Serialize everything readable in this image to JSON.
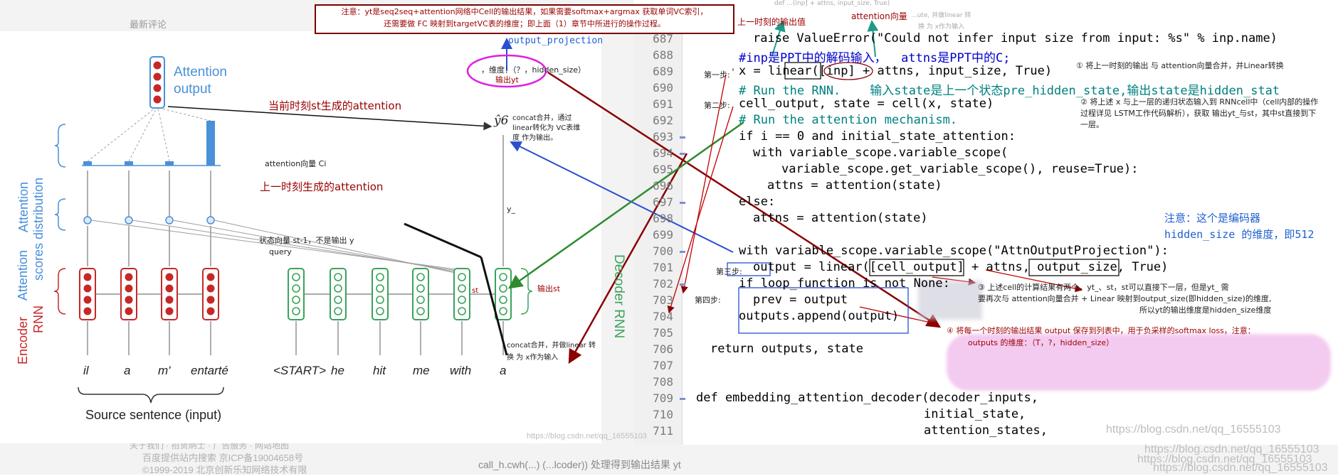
{
  "top_note": {
    "line1": "注意：yt是seq2seq+attention网络中Cell的输出结果，如果需要softmax+argmax 获取单词VC索引，",
    "line2": "还需要做 FC 映射到targetVC表的维度；即上面（1）章节中所进行的操作过程。"
  },
  "background": {
    "recent_comments": "最新评论",
    "footer1": "百度提供站内搜索 京ICP备19004658号",
    "footer2": "©1999-2019 北京创新乐知网络技术有限",
    "partial_link": "关于我们 · 招贤纳士 · 广告服务 · 网站地图",
    "bottom_code": "call_h.cwh(...)  (...lcoder)) 处理得到输出结果 yt"
  },
  "diagram": {
    "attention_output": [
      "Attention",
      "output"
    ],
    "attention_distribution": [
      "Attention",
      "distribution"
    ],
    "attention_scores": [
      "Attention",
      "scores"
    ],
    "encoder_rnn": [
      "Encoder",
      "RNN"
    ],
    "decoder_rnn": "Decoder RNN",
    "source_words": [
      "il",
      "a",
      "m'",
      "entarté"
    ],
    "target_words": [
      "<START>",
      "he",
      "hit",
      "me",
      "with",
      "a"
    ],
    "source_sentence": "Source sentence (input)",
    "y_hat": "ŷ6",
    "current_attention": "当前时刻st生成的attention",
    "prev_attention": "上一时刻生成的attention",
    "attention_vector_ci": "attention向量 Ci",
    "state_vector": "状态向量 st-1，不是输出 y",
    "query": "query",
    "concat_note_1": "concat合并，通过",
    "concat_note_2": "linear转化为 VC表维",
    "concat_note_3": "度 作为输出。",
    "y_underscore": "y_",
    "st_label": "st",
    "output_st": "输出st",
    "concat_note_b1": "concat合并，并做linear 转",
    "concat_note_b2": "换 为 x作为输入",
    "output_projection": "output_projection",
    "dim_label": "，维度：（？，hidden_size）",
    "output_yt": "输出yt"
  },
  "code": {
    "lines": [
      {
        "num": "687",
        "text": "raise ValueError(\"Could not infer input size from input: %s\" % inp.name)"
      },
      {
        "num": "688",
        "text": "#inp是PPT中的解码输入，  attns是PPT中的C;"
      },
      {
        "num": "689",
        "text": "x = linear([inp] + attns, input_size, True)"
      },
      {
        "num": "690",
        "text": "# Run the RNN.    输入state是上一个状态pre_hidden_state,输出state是hidden_stat"
      },
      {
        "num": "691",
        "text": "cell_output, state = cell(x, state)"
      },
      {
        "num": "692",
        "text": "# Run the attention mechanism."
      },
      {
        "num": "693",
        "text": "if i == 0 and initial_state_attention:"
      },
      {
        "num": "694",
        "text": "with variable_scope.variable_scope("
      },
      {
        "num": "695",
        "text": "variable_scope.get_variable_scope(), reuse=True):"
      },
      {
        "num": "696",
        "text": "attns = attention(state)"
      },
      {
        "num": "697",
        "text": "else:"
      },
      {
        "num": "698",
        "text": "attns = attention(state)"
      },
      {
        "num": "699",
        "text": ""
      },
      {
        "num": "700",
        "text": "with variable_scope.variable_scope(\"AttnOutputProjection\"):"
      },
      {
        "num": "701",
        "text": "output = linear([cell_output] + attns, output_size, True)"
      },
      {
        "num": "702",
        "text": "if loop_function is not None:"
      },
      {
        "num": "703",
        "text": "prev = output"
      },
      {
        "num": "704",
        "text": "outputs.append(output)"
      },
      {
        "num": "705",
        "text": ""
      },
      {
        "num": "706",
        "text": "return outputs, state"
      },
      {
        "num": "707",
        "text": ""
      },
      {
        "num": "708",
        "text": ""
      },
      {
        "num": "709",
        "text": "def embedding_attention_decoder(decoder_inputs,"
      },
      {
        "num": "710",
        "text": "initial_state,"
      },
      {
        "num": "711",
        "text": "attention_states,"
      }
    ]
  },
  "annotations": {
    "prev_output": "上一时刻的输出值",
    "attn_vector": "attention向量",
    "top_right_code": "def  ...(inp] + attns, input_size, True)",
    "top_right_2": "...ute, 并做linear 转",
    "top_right_3": "换 为 x作为输入",
    "step1": "第一步:",
    "step2": "第二步:",
    "step3": "第三步:",
    "step4": "第四步:",
    "note1": "① 将上一时刻的输出 与 attention向量合并，并Linear转换",
    "note2_l1": "② 将上述 x 与上一层的递归状态输入到 RNNcell中（cell内部的操作",
    "note2_l2": "过程详见 LSTM工作代码解析），获取 输出yt_与st，其中st直接到下",
    "note2_l3": "一层。",
    "note3_l1": "③ 上述cell的计算结果有两个，yt_、st，st可以直接下一层，但是yt_ 需",
    "note3_l2": "要再次与 attention向量合并 + Linear 映射到output_size(即hidden_size)的维度,",
    "note3_l3": "所以yt的输出维度是hidden_size维度",
    "note4_l1": "④ 将每一个时刻的输出结果 output 保存到列表中，用于负采样的softmax loss，注意：",
    "note4_l2": "outputs 的维度：（T，?，hidden_size）",
    "encoder_note_l1": "注意：这个是编码器",
    "encoder_note_l2": "hidden_size 的维度，即512"
  },
  "watermarks": {
    "csdn": "https://blog.csdn.net/qq_16555103",
    "csdn_short": "https://blog.csdn.net/qq_16555103"
  },
  "colors": {
    "diagram_blue": "#4a90d9",
    "encoder_red": "#c62828",
    "decoder_green": "#3aa35a",
    "annotation_darkred": "#9b0000",
    "arrow_darkred": "#8b0000",
    "arrow_green": "#2e8b2e",
    "arrow_blue": "#2a4fd0",
    "magenta": "#e020e0"
  }
}
